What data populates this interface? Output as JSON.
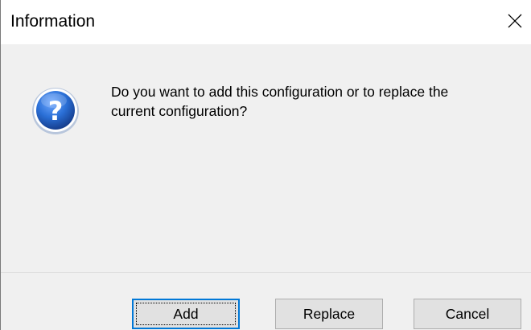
{
  "dialog": {
    "title": "Information",
    "message_line1": "Do you want to add this configuration or to replace the",
    "message_line2": "current configuration?",
    "icon": "question-icon",
    "close_icon": "close-icon"
  },
  "buttons": {
    "add_label": "Add",
    "replace_label": "Replace",
    "cancel_label": "Cancel",
    "default": "Add"
  },
  "colors": {
    "accent": "#0078d7",
    "icon_blue": "#1f5fbf",
    "dialog_bg": "#f0f0f0",
    "button_bg": "#e1e1e1"
  }
}
